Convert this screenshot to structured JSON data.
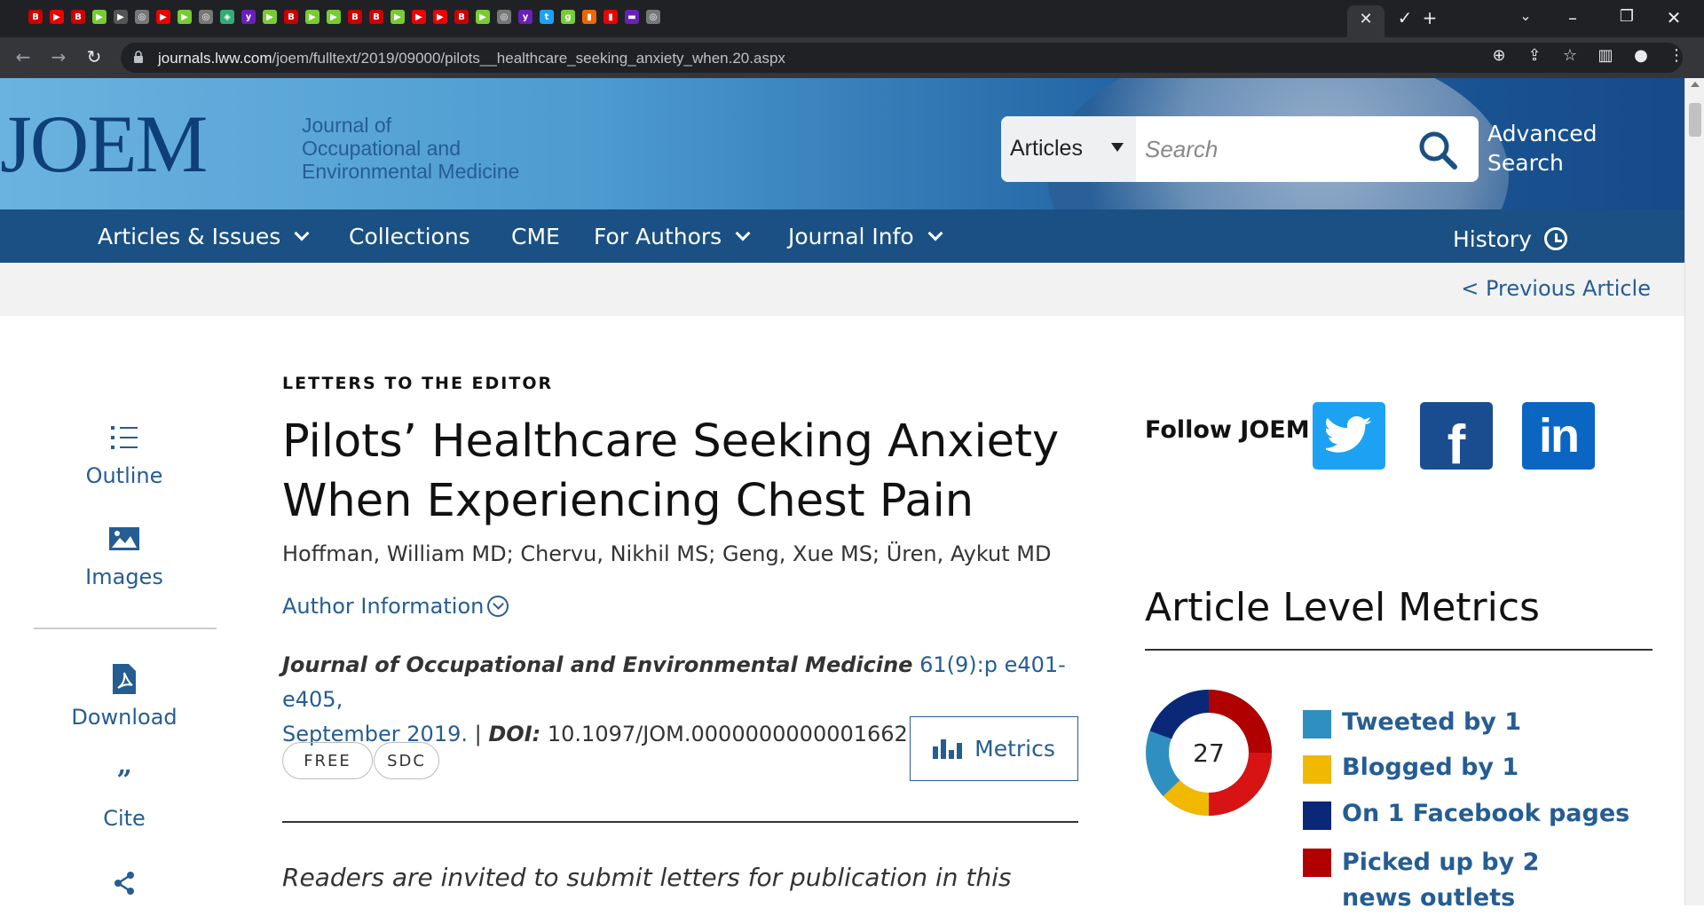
{
  "browser": {
    "url_domain": "journals.lww.com",
    "url_path": "/joem/fulltext/2019/09000/pilots__healthcare_seeking_anxiety_when.20.aspx"
  },
  "header": {
    "logo": "JOEM",
    "journal_name_lines": [
      "Journal of",
      "Occupational and",
      "Environmental Medicine"
    ],
    "search_scope": "Articles",
    "search_placeholder": "Search",
    "advanced_search_lines": [
      "Advanced",
      "Search"
    ]
  },
  "nav": {
    "items": [
      {
        "label": "Articles & Issues",
        "dropdown": true
      },
      {
        "label": "Collections",
        "dropdown": false
      },
      {
        "label": "CME",
        "dropdown": false
      },
      {
        "label": "For Authors",
        "dropdown": true
      },
      {
        "label": "Journal Info",
        "dropdown": true
      }
    ],
    "history": "History"
  },
  "subbar": {
    "previous": "< Previous Article"
  },
  "tools": [
    {
      "label": "Outline",
      "icon": "outline-icon"
    },
    {
      "label": "Images",
      "icon": "images-icon"
    },
    {
      "label": "Download",
      "icon": "download-icon"
    },
    {
      "label": "Cite",
      "icon": "cite-icon"
    },
    {
      "label": "",
      "icon": "share-icon"
    }
  ],
  "article": {
    "kicker": "LETTERS TO THE EDITOR",
    "title_lines": [
      "Pilots’ Healthcare Seeking Anxiety",
      "When Experiencing Chest Pain"
    ],
    "authors": "Hoffman, William MD; Chervu, Nikhil MS; Geng, Xue MS; Üren, Aykut MD",
    "author_info": "Author Information",
    "journal": "Journal of Occupational and Environmental Medicine",
    "volume": "61(9):p e401-e405,",
    "date": "September 2019.",
    "doi_label": "DOI:",
    "doi": "10.1097/JOM.0000000000001662",
    "tags": [
      "FREE",
      "SDC"
    ],
    "metrics_button": "Metrics",
    "intro": "Readers are invited to submit letters for publication in this"
  },
  "sidebar": {
    "follow": "Follow JOEM",
    "metrics_heading": "Article Level Metrics",
    "altmetric_score": "27",
    "altmetric_lines": [
      {
        "text": "Tweeted by 1",
        "color": "#2f8fc0"
      },
      {
        "text": "Blogged by 1",
        "color": "#f1b800"
      },
      {
        "text": "On 1 Facebook pages",
        "color": "#0b2878"
      },
      {
        "text": "Picked up by 2 news outlets",
        "color": "#b00000"
      }
    ]
  },
  "colors": {
    "link": "#255d93",
    "nav": "#1a5083"
  }
}
